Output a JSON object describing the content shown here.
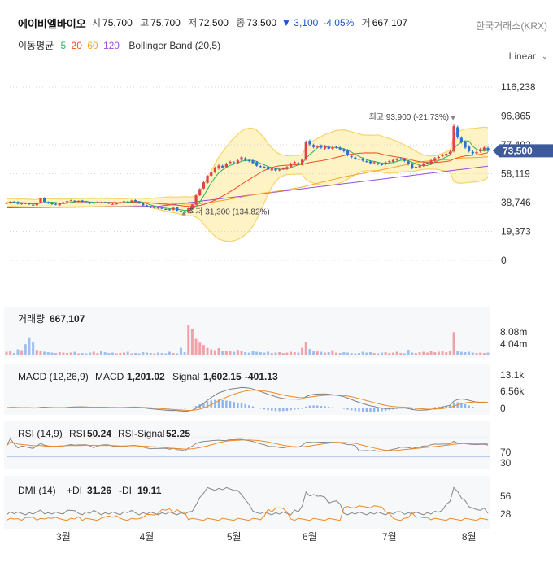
{
  "header": {
    "name": "에이비엘바이오",
    "open_label": "시",
    "open": "75,700",
    "high_label": "고",
    "high": "75,700",
    "low_label": "저",
    "low": "72,500",
    "close_label": "종",
    "close": "73,500",
    "change_arrow": "▼",
    "change": "3,100",
    "change_pct": "-4.05%",
    "volume_label": "거",
    "volume": "667,107",
    "exchange": "한국거래소(KRX)"
  },
  "indicators": {
    "ma_label": "이동평균",
    "ma5": "5",
    "ma20": "20",
    "ma60": "60",
    "ma120": "120",
    "bb_label": "Bollinger Band (20,5)",
    "scale": "Linear",
    "scale_chevron": "⌄"
  },
  "colors": {
    "up": "#e0414d",
    "down": "#2f6fd6",
    "ma5": "#2db35d",
    "ma20": "#f04f23",
    "ma60": "#f5a623",
    "ma120": "#9b4dde",
    "bb_line": "#f7d36b",
    "bb_fill": "#fdf3c4",
    "price_tag": "#3d5a9c",
    "macd": "#808080",
    "signal": "#f08a24"
  },
  "chart_data": [
    {
      "type": "line",
      "name": "price",
      "x_ticks": [
        "3월",
        "4월",
        "5월",
        "6월",
        "7월",
        "8월"
      ],
      "y_ticks": [
        "116,238",
        "96,865",
        "77,492",
        "58,119",
        "38,746",
        "19,373",
        "0"
      ],
      "ylim": [
        0,
        116238
      ],
      "current_price": "73,500",
      "annotations": {
        "high": {
          "text": "최고 93,900 (-21.73%)",
          "value": 93900
        },
        "low": {
          "text": "최저 31,300 (134.82%)",
          "value": 31300
        }
      },
      "closes": [
        38500,
        39200,
        38800,
        37900,
        38400,
        38100,
        37600,
        37000,
        38400,
        41500,
        39300,
        38200,
        37600,
        37300,
        38200,
        38900,
        39700,
        40200,
        39600,
        39800,
        39300,
        38800,
        38200,
        38700,
        39100,
        38900,
        38600,
        38100,
        37800,
        38300,
        38900,
        39700,
        39400,
        40100,
        39600,
        38300,
        36800,
        35900,
        35300,
        35600,
        34900,
        34700,
        34300,
        33800,
        35200,
        33400,
        32900,
        31800,
        34900,
        37400,
        43500,
        47800,
        52300,
        56700,
        58900,
        62100,
        63600,
        62300,
        64800,
        66100,
        65600,
        67000,
        69100,
        67300,
        66600,
        65200,
        63500,
        62700,
        62300,
        60900,
        61600,
        60300,
        60900,
        61700,
        62600,
        64800,
        65900,
        64500,
        67500,
        79400,
        77800,
        76000,
        76300,
        75600,
        76500,
        74800,
        75400,
        75900,
        74400,
        73200,
        70600,
        69200,
        67800,
        67600,
        66900,
        66300,
        65200,
        65800,
        64600,
        64300,
        65600,
        66500,
        67300,
        67900,
        68300,
        66700,
        64400,
        61800,
        62800,
        63500,
        64900,
        65200,
        66900,
        68500,
        69300,
        70700,
        71500,
        72800,
        90100,
        82400,
        79300,
        75600,
        73200,
        71800,
        72600,
        74500,
        75600,
        73500
      ],
      "ma5": "close 5-day moving average",
      "ma20": "close 20-day moving average",
      "ma60": "close 60-day moving average",
      "ma120": "close 120-day moving average",
      "bollinger": "20-day, 5 std"
    },
    {
      "type": "bar",
      "name": "volume",
      "label": "거래량",
      "value": "667,107",
      "y_ticks": [
        "8.08m",
        "4.04m"
      ],
      "ylim": [
        0,
        10000000
      ],
      "values": [
        0.9,
        1.2,
        0.6,
        1.5,
        1.3,
        2.8,
        4.5,
        3.2,
        1.4,
        1.2,
        0.9,
        0.8,
        0.7,
        0.6,
        0.8,
        0.7,
        0.6,
        0.7,
        0.9,
        0.5,
        0.6,
        0.5,
        0.7,
        0.9,
        0.6,
        1.1,
        0.8,
        0.6,
        0.7,
        0.5,
        0.6,
        0.7,
        0.9,
        0.5,
        0.6,
        0.5,
        0.8,
        0.7,
        0.6,
        0.5,
        0.7,
        0.6,
        0.5,
        0.9,
        0.6,
        0.5,
        1.9,
        0.8,
        7.6,
        6.6,
        4.1,
        3.2,
        2.6,
        1.9,
        1.5,
        1.3,
        1.8,
        1.2,
        1.1,
        1.0,
        0.9,
        1.4,
        1.2,
        0.8,
        0.7,
        1.1,
        0.9,
        0.8,
        0.7,
        0.9,
        0.6,
        0.7,
        0.8,
        0.6,
        0.7,
        0.9,
        0.8,
        0.7,
        1.9,
        3.4,
        1.6,
        1.1,
        1.0,
        0.9,
        0.7,
        0.8,
        1.3,
        0.7,
        0.6,
        0.8,
        0.7,
        0.6,
        0.5,
        0.6,
        0.9,
        0.7,
        0.8,
        0.6,
        0.5,
        0.7,
        0.8,
        0.6,
        0.7,
        0.9,
        0.6,
        0.5,
        1.4,
        0.7,
        0.6,
        0.8,
        0.9,
        0.7,
        1.2,
        0.8,
        0.9,
        1.0,
        0.8,
        1.2,
        5.8,
        1.1,
        0.9,
        0.8,
        0.9,
        0.7,
        0.6,
        0.7,
        0.6,
        0.7
      ]
    },
    {
      "type": "line",
      "name": "MACD",
      "label": "MACD (12,26,9)",
      "macd_label": "MACD",
      "macd_value": "1,201.02",
      "signal_label": "Signal",
      "signal_value": "1,602.15",
      "osc_value": "-401.13",
      "y_ticks": [
        "13.1k",
        "6.56k",
        "0"
      ],
      "ylim": [
        -3000,
        14000
      ]
    },
    {
      "type": "line",
      "name": "RSI",
      "label": "RSI (14,9)",
      "rsi_label": "RSI",
      "rsi_value": "50.24",
      "signal_label": "RSI-Signal",
      "signal_value": "52.25",
      "y_ticks": [
        "70",
        "30"
      ],
      "ylim": [
        0,
        100
      ]
    },
    {
      "type": "line",
      "name": "DMI",
      "label": "DMI (14)",
      "pdi_label": "+DI",
      "pdi_value": "31.26",
      "mdi_label": "-DI",
      "mdi_value": "19.11",
      "y_ticks": [
        "56",
        "28"
      ],
      "ylim": [
        0,
        70
      ]
    }
  ]
}
